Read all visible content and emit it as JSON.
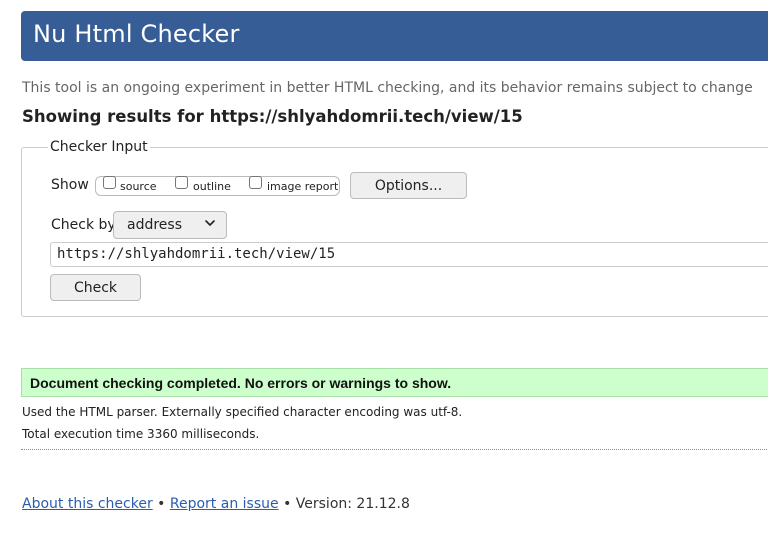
{
  "header": {
    "title": "Nu Html Checker"
  },
  "tagline": "This tool is an ongoing experiment in better HTML checking, and its behavior remains subject to change",
  "results_heading": "Showing results for https://shlyahdomrii.tech/view/15",
  "checker_input": {
    "legend": "Checker Input",
    "show_label": "Show",
    "show_options": [
      {
        "label": "source",
        "checked": false
      },
      {
        "label": "outline",
        "checked": false
      },
      {
        "label": "image report",
        "checked": false
      }
    ],
    "options_button": "Options...",
    "check_by_label": "Check by",
    "check_by_value": "address",
    "url_value": "https://shlyahdomrii.tech/view/15",
    "check_button": "Check"
  },
  "result": {
    "message": "Document checking completed. No errors or warnings to show.",
    "parser_info": "Used the HTML parser. Externally specified character encoding was utf-8.",
    "execution_time": "Total execution time 3360 milliseconds."
  },
  "footer": {
    "about_link": "About this checker",
    "separator": "•",
    "report_link": "Report an issue",
    "version": "Version: 21.12.8"
  },
  "colors": {
    "header_bg": "#365d95",
    "success_bg": "#ccffcc",
    "link": "#2a5db0"
  },
  "icons": {
    "select_arrow": "chevron-down-icon"
  }
}
